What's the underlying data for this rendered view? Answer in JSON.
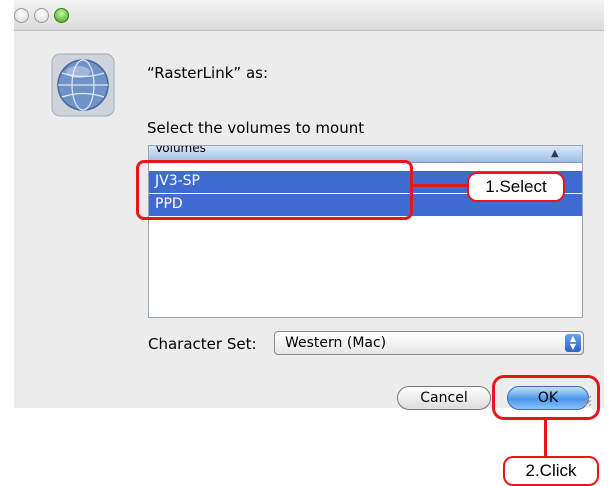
{
  "dialog": {
    "server_label": "“RasterLink” as:",
    "prompt": "Select the volumes to mount"
  },
  "volume_list": {
    "header": "Volumes",
    "items": [
      {
        "label": "JV3-SP",
        "selected": true
      },
      {
        "label": "PPD",
        "selected": true
      }
    ]
  },
  "charset": {
    "label": "Character Set:",
    "value": "Western (Mac)"
  },
  "buttons": {
    "cancel": "Cancel",
    "ok": "OK"
  },
  "annotations": {
    "select": "1.Select",
    "click": "2.Click"
  },
  "colors": {
    "selection": "#3e6bcf",
    "callout": "#e8161b",
    "zoom_button": "#3aa312"
  },
  "icons": [
    "network-globe-icon",
    "sort-arrow-icon",
    "popup-arrows-icon",
    "resize-grip-icon"
  ]
}
